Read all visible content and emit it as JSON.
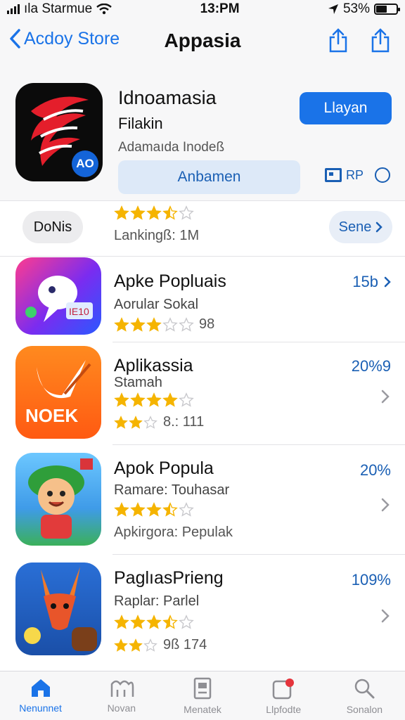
{
  "status_bar": {
    "carrier": "ıla Starmue",
    "time": "13:PM",
    "battery": "53%"
  },
  "nav": {
    "back_label": "Acdoy Store",
    "title": "Appasia"
  },
  "featured": {
    "name": "Idnoamasia",
    "subtitle": "Filakin",
    "developer": "Adamaıda Inodeß",
    "badge": "AO",
    "get_label": "Llayan",
    "secondary_label": "Anbamen",
    "extra_label": "RP"
  },
  "filter": {
    "chip_label": "DoNis",
    "rating_stars": 3.5,
    "ranking": "Lankingß: 1M",
    "see_label": "Sene"
  },
  "apps": [
    {
      "name": "Apke Popluais",
      "category": "Aorular Sokal",
      "stars": 3,
      "stars_text": "98",
      "stat": "15b",
      "extra": null,
      "extra_stars": 0
    },
    {
      "name": "Aplikassia",
      "category": "Stamah",
      "stars": 4,
      "stars_text": "",
      "stat": "20%9",
      "extra": "8.: 111",
      "extra_stars": 2
    },
    {
      "name": "Apok Popula",
      "category": "Ramare: Touhasar",
      "stars": 3.5,
      "stars_text": "",
      "stat": "20%",
      "extra": "Apkirgora: Pepulak",
      "extra_stars": 0
    },
    {
      "name": "PaglıasPrieng",
      "category": "Raplar: Parlel",
      "stars": 3.5,
      "stars_text": "",
      "stat": "109%",
      "extra": "9ß 174",
      "extra_stars": 2
    }
  ],
  "tabs": [
    {
      "label": "Nenunnet",
      "icon": "home-icon",
      "active": true
    },
    {
      "label": "Novan",
      "icon": "apps-icon",
      "active": false
    },
    {
      "label": "Menatek",
      "icon": "arcade-icon",
      "active": false
    },
    {
      "label": "Llpfodte",
      "icon": "updates-icon",
      "active": false
    },
    {
      "label": "Sonalon",
      "icon": "search-icon",
      "active": false
    }
  ],
  "colors": {
    "accent": "#1a73e8",
    "star": "#f5b400",
    "star_empty": "#c8c8cc"
  }
}
